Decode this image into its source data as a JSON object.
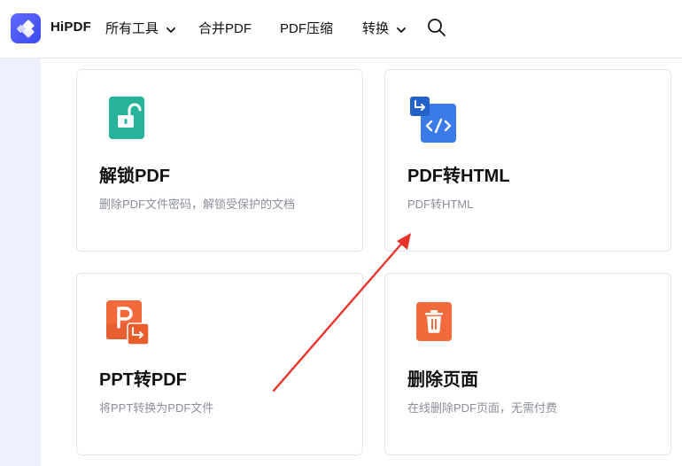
{
  "header": {
    "brand": "HiPDF",
    "nav": [
      {
        "label": "所有工具",
        "has_dropdown": true
      },
      {
        "label": "合并PDF",
        "has_dropdown": false
      },
      {
        "label": "PDF压缩",
        "has_dropdown": false
      },
      {
        "label": "转换",
        "has_dropdown": true
      }
    ],
    "search_icon": "search-icon"
  },
  "cards": [
    {
      "title": "解锁PDF",
      "desc": "删除PDF文件密码，解锁受保护的文档",
      "icon": "unlock-icon",
      "color": "#25b39a"
    },
    {
      "title": "PDF转HTML",
      "desc": "PDF转HTML",
      "icon": "html-code-icon",
      "color": "#3a7be8"
    },
    {
      "title": "PPT转PDF",
      "desc": "将PPT转换为PDF文件",
      "icon": "ppt-icon",
      "color": "#f26a3c"
    },
    {
      "title": "删除页面",
      "desc": "在线删除PDF页面，无需付费",
      "icon": "trash-icon",
      "color": "#f26a3c"
    }
  ],
  "colors": {
    "brand": "#4b58f5",
    "sidebar": "#eef0fd",
    "annotation_arrow": "#e8342b"
  }
}
